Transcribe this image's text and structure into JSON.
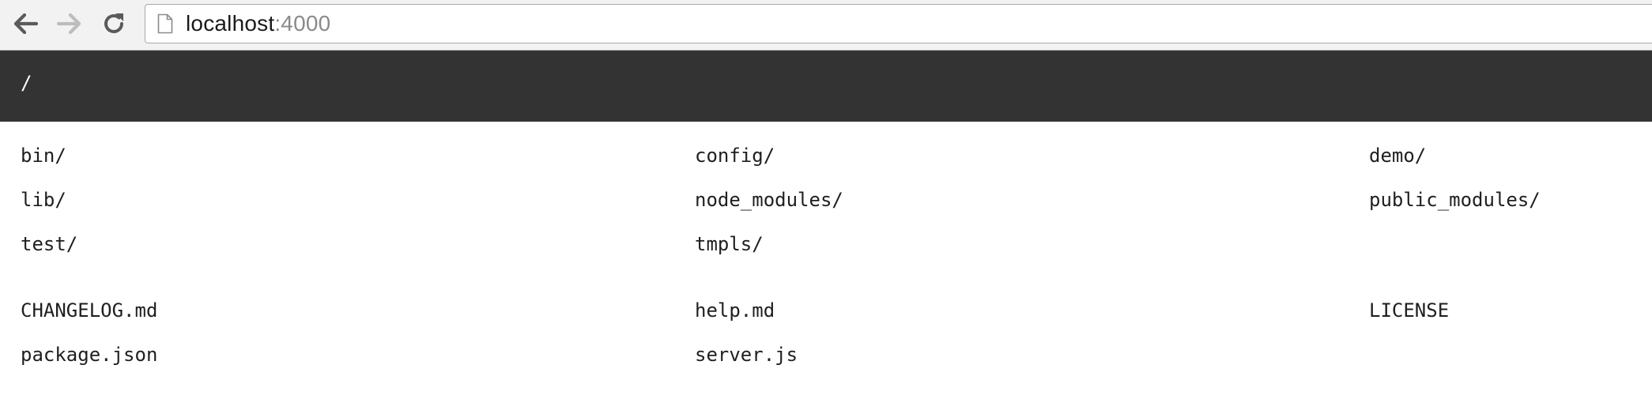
{
  "browser": {
    "url_host": "localhost",
    "url_port": ":4000",
    "icons": {
      "back": "arrow-left-icon",
      "forward": "arrow-right-icon",
      "reload": "reload-icon",
      "page": "document-icon"
    }
  },
  "header": {
    "path": "/"
  },
  "directories": [
    "bin/",
    "config/",
    "demo/",
    "lib/",
    "node_modules/",
    "public_modules/",
    "test/",
    "tmpls/"
  ],
  "files": [
    "CHANGELOG.md",
    "help.md",
    "LICENSE",
    "package.json",
    "server.js"
  ],
  "colors": {
    "header_bg": "#333333",
    "toolbar_bg": "#f2f2f2",
    "text": "#1f1f1f"
  }
}
